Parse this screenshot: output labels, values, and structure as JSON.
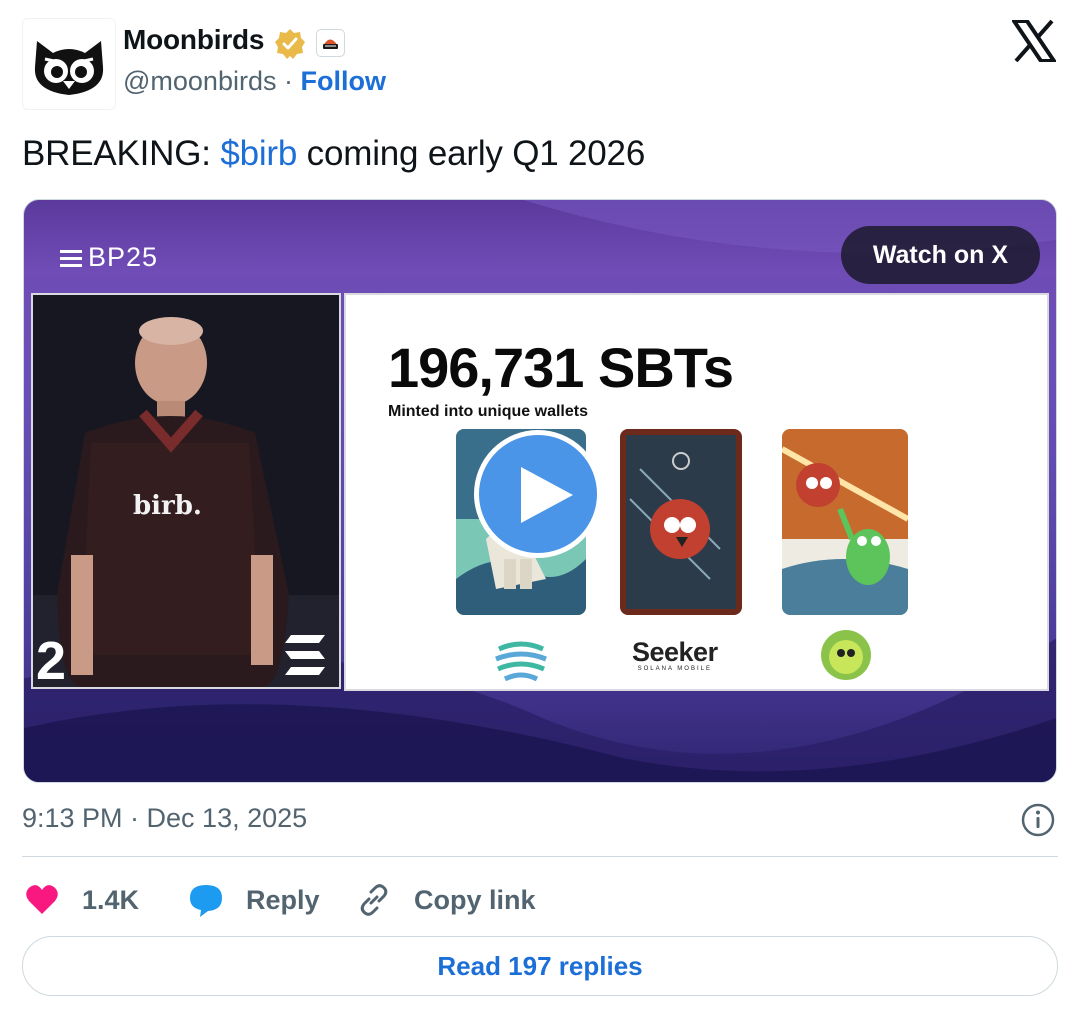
{
  "author": {
    "name": "Moonbirds",
    "handle": "@moonbirds",
    "separator": "·",
    "follow_label": "Follow",
    "verified_color": "#e9b949",
    "icons": [
      "owl-avatar",
      "verified-badge-icon",
      "affiliation-badge-icon",
      "x-logo-icon"
    ]
  },
  "tweet": {
    "prefix": "BREAKING: ",
    "cashtag": "$birb",
    "suffix": " coming early Q1 2026"
  },
  "media": {
    "event_tag": "BP25",
    "watch_label": "Watch on X",
    "shirt_text": "birb.",
    "stage_digit": "2",
    "slide_title": "196,731 SBTs",
    "slide_subtitle": "Minted into unique wallets",
    "partner_name": "Seeker",
    "partner_sub": "SOLANA MOBILE",
    "play_icon": "play-icon"
  },
  "meta": {
    "timestamp": "9:13 PM · Dec 13, 2025"
  },
  "actions": {
    "likes": "1.4K",
    "reply_label": "Reply",
    "copy_label": "Copy link",
    "read_replies_label": "Read 197 replies"
  },
  "colors": {
    "link": "#1d6fd8",
    "heart": "#f91880",
    "reply_bubble": "#1d9bf0",
    "muted": "#536471"
  }
}
